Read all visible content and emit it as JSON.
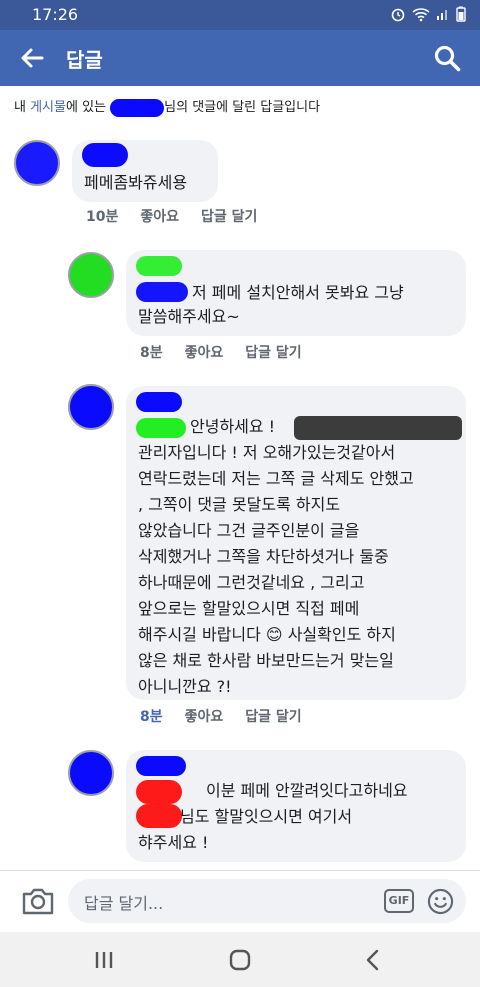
{
  "status_bar": {
    "time": "17:26"
  },
  "header": {
    "title": "답글"
  },
  "context": {
    "prefix": "내 ",
    "link": "게시물",
    "mid": "에 있는 ",
    "suffix": "님의 댓글에 달린 답글입니다"
  },
  "comments": [
    {
      "text_lines": [
        "페메좀봐쥬세용"
      ],
      "time": "10분",
      "like": "좋아요",
      "reply": "답글 달기",
      "avatar_color": "#1a1aff",
      "name_color": "#0b0bff"
    },
    {
      "text_lines": [
        "저 페메 설치안해서 못봐요  그냥",
        "말씀해주세요~"
      ],
      "time": "8분",
      "like": "좋아요",
      "reply": "답글 달기",
      "avatar_color": "#22dd22",
      "name_color": "#33ee33"
    },
    {
      "text_lines": [
        "안녕하세요 !",
        "관리자입니다 ! 저 오해가있는것같아서",
        "연락드렸는데 저는 그쪽 글 삭제도 안했고",
        ", 그쪽이 댓글 못달도록 하지도",
        "않았습니다 그건 글주인분이 글을",
        "삭제했거나 그쪽을 차단하셧거나 둘중",
        "하나때문에 그런것같네요 , 그리고",
        "앞으로는 할말있으시면 직접 페메",
        "해주시길 바랍니다 😊 사실확인도 하지",
        "않은 채로 한사람 바보만드는거 맞는일",
        "아니니깐요 ?!"
      ],
      "time": "8분",
      "like": "좋아요",
      "reply": "답글 달기",
      "avatar_color": "#0a0aff"
    },
    {
      "text_lines": [
        "이분 페메 안깔려잇다고하네요",
        "님도 할말잇으시면 여기서",
        "햐주세요 !"
      ],
      "avatar_color": "#0a0aff"
    }
  ],
  "composer": {
    "placeholder": "답글 달기...",
    "gif_label": "GIF"
  },
  "colors": {
    "brand": "#4267b2",
    "status": "#3b5998",
    "bubble": "#f0f2f5"
  }
}
